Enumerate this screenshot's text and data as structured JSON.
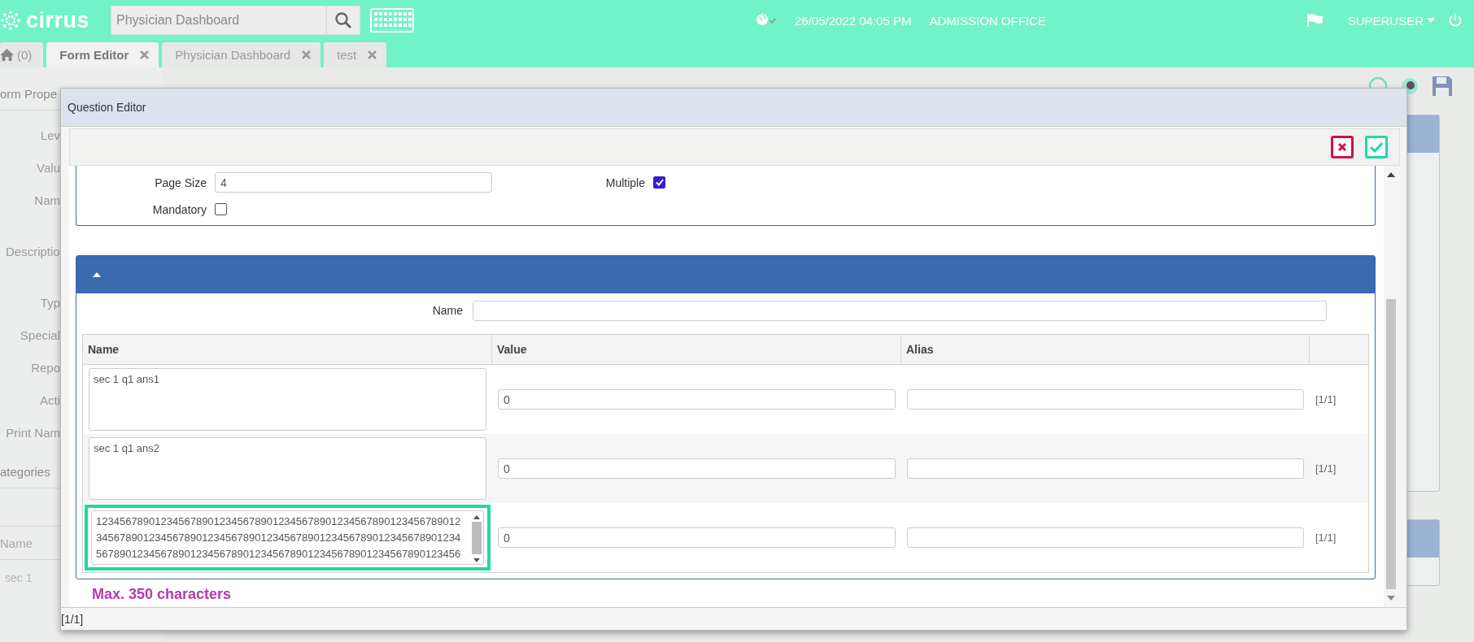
{
  "top_bar": {
    "logo": "cirrus",
    "search": {
      "placeholder": "Physician Dashboard"
    },
    "datetime": "26/05/2022 04:05 PM",
    "location": "ADMISSION OFFICE",
    "user": "SUPERUSER"
  },
  "tabs": [
    {
      "kind": "home",
      "label": "(0)",
      "selected": false
    },
    {
      "kind": "page",
      "label": "Form Editor",
      "selected": true
    },
    {
      "kind": "page",
      "label": "Physician Dashboard",
      "selected": false
    },
    {
      "kind": "page",
      "label": "test",
      "selected": false
    }
  ],
  "background_panel": {
    "title": "orm Prope",
    "labels": [
      {
        "kind": "short",
        "text": "Lev"
      },
      {
        "kind": "short",
        "text": "Valu"
      },
      {
        "kind": "short",
        "text": "Nam"
      },
      {
        "kind": "tall",
        "text": "Descriptio"
      },
      {
        "kind": "short",
        "text": "Typ"
      },
      {
        "kind": "short",
        "text": "Special"
      },
      {
        "kind": "short",
        "text": "Repo"
      },
      {
        "kind": "short",
        "text": "Acti"
      },
      {
        "kind": "short",
        "text": "Print Nam"
      }
    ],
    "categories": {
      "title": "ategories",
      "column": "Name",
      "cell": "sec 1"
    }
  },
  "dialog": {
    "title": "Question Editor",
    "page_size": {
      "label": "Page Size",
      "value": "4"
    },
    "multiple": {
      "label": "Multiple",
      "checked": true
    },
    "mandatory": {
      "label": "Mandatory",
      "checked": false
    },
    "answers": {
      "expanded": true,
      "name_label": "Name",
      "columns": [
        "Name",
        "Value",
        "Alias"
      ],
      "rows": [
        {
          "name": [
            "sec 1 q1 ans1"
          ],
          "value": "0",
          "pager": "[1/1]",
          "highlighted": false,
          "scrollable": false
        },
        {
          "name": [
            "sec 1 q1 ans2"
          ],
          "value": "0",
          "pager": "[1/1]",
          "highlighted": false,
          "scrollable": false
        },
        {
          "name": [
            "12345678901234567890123456789012345678901234567890123456789012",
            "34567890123456789012345678901234567890123456789012345678901234",
            "56789012345678901234567890123456789012345678901234567890123456"
          ],
          "value": "0",
          "pager": "[1/1]",
          "highlighted": true,
          "scrollable": true
        }
      ]
    },
    "note": "Max. 350 characters",
    "footer": "[1/1]"
  }
}
